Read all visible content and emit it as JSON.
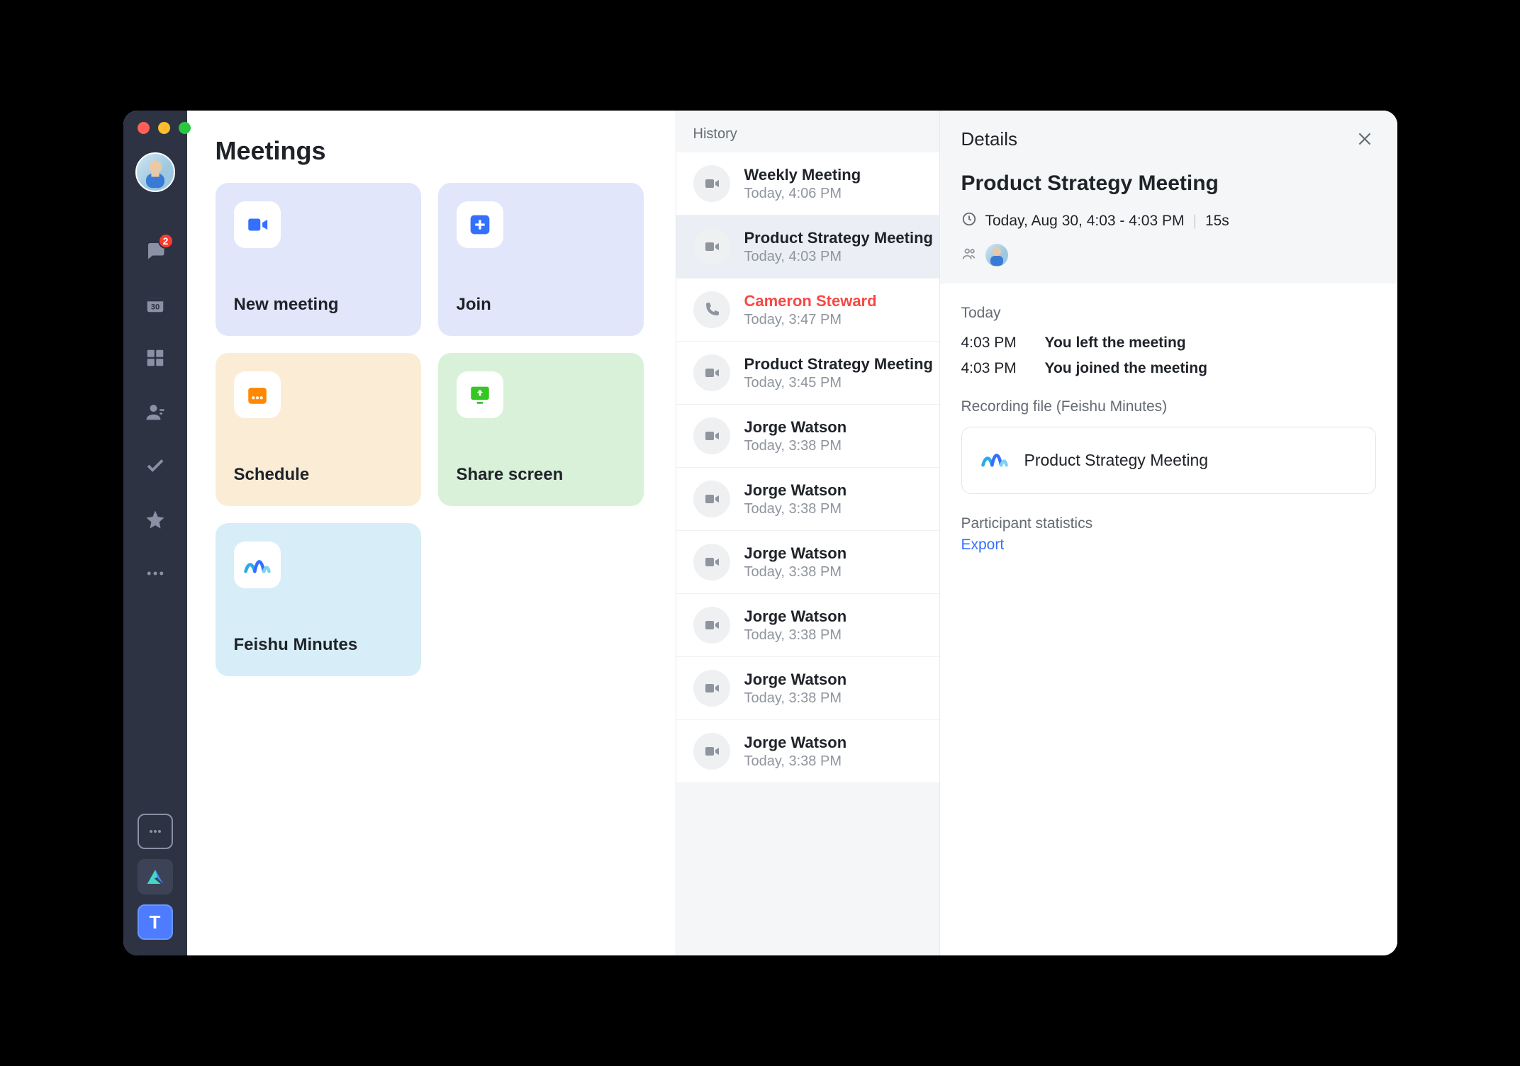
{
  "window": {
    "traffic": [
      "close",
      "minimize",
      "maximize"
    ]
  },
  "sidebar": {
    "nav": [
      {
        "name": "chat-icon",
        "badge": 2
      },
      {
        "name": "calendar-icon"
      },
      {
        "name": "apps-icon"
      },
      {
        "name": "contacts-icon"
      },
      {
        "name": "tasks-icon"
      },
      {
        "name": "favorites-icon"
      },
      {
        "name": "more-icon"
      }
    ],
    "bottom": [
      {
        "name": "more-apps"
      },
      {
        "name": "feishu-app"
      },
      {
        "name": "t-app",
        "letter": "T"
      }
    ]
  },
  "main": {
    "title": "Meetings",
    "tiles": [
      {
        "key": "new",
        "label": "New meeting",
        "icon": "video-plus-icon",
        "class": "tile-blue"
      },
      {
        "key": "join",
        "label": "Join",
        "icon": "plus-icon",
        "class": "tile-blue2"
      },
      {
        "key": "schedule",
        "label": "Schedule",
        "icon": "calendar-icon",
        "class": "tile-orange"
      },
      {
        "key": "share",
        "label": "Share screen",
        "icon": "share-screen-icon",
        "class": "tile-green"
      },
      {
        "key": "minutes",
        "label": "Feishu Minutes",
        "icon": "minutes-icon",
        "class": "tile-cyan"
      }
    ]
  },
  "history": {
    "header": "History",
    "items": [
      {
        "title": "Weekly Meeting",
        "time": "Today, 4:06 PM",
        "icon": "video",
        "selected": false
      },
      {
        "title": "Product Strategy Meeting",
        "time": "Today, 4:03 PM",
        "icon": "video",
        "selected": true
      },
      {
        "title": "Cameron Steward",
        "time": "Today, 3:47 PM",
        "icon": "phone",
        "missed": true
      },
      {
        "title": "Product Strategy Meeting",
        "time": "Today, 3:45 PM",
        "icon": "video"
      },
      {
        "title": "Jorge Watson",
        "time": "Today, 3:38 PM",
        "icon": "video"
      },
      {
        "title": "Jorge Watson",
        "time": "Today, 3:38 PM",
        "icon": "video"
      },
      {
        "title": "Jorge Watson",
        "time": "Today, 3:38 PM",
        "icon": "video"
      },
      {
        "title": "Jorge Watson",
        "time": "Today, 3:38 PM",
        "icon": "video"
      },
      {
        "title": "Jorge Watson",
        "time": "Today, 3:38 PM",
        "icon": "video"
      },
      {
        "title": "Jorge Watson",
        "time": "Today, 3:38 PM",
        "icon": "video"
      }
    ]
  },
  "details": {
    "header": "Details",
    "meeting_title": "Product Strategy Meeting",
    "time": "Today, Aug 30, 4:03 - 4:03 PM",
    "duration": "15s",
    "events_day": "Today",
    "events": [
      {
        "time": "4:03 PM",
        "text": "You left the meeting"
      },
      {
        "time": "4:03 PM",
        "text": "You joined the meeting"
      }
    ],
    "recording_label": "Recording file (Feishu Minutes)",
    "recording_title": "Product Strategy Meeting",
    "stats_label": "Participant statistics",
    "export": "Export"
  }
}
